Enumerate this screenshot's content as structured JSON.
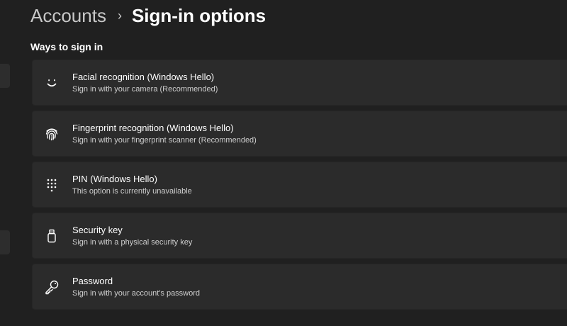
{
  "breadcrumb": {
    "parent": "Accounts",
    "separator": "›",
    "current": "Sign-in options"
  },
  "section": {
    "title": "Ways to sign in"
  },
  "sign_in_options": [
    {
      "icon": "face-icon",
      "title": "Facial recognition (Windows Hello)",
      "subtitle": "Sign in with your camera (Recommended)"
    },
    {
      "icon": "fingerprint-icon",
      "title": "Fingerprint recognition (Windows Hello)",
      "subtitle": "Sign in with your fingerprint scanner (Recommended)"
    },
    {
      "icon": "keypad-icon",
      "title": "PIN (Windows Hello)",
      "subtitle": "This option is currently unavailable"
    },
    {
      "icon": "usb-key-icon",
      "title": "Security key",
      "subtitle": "Sign in with a physical security key"
    },
    {
      "icon": "key-icon",
      "title": "Password",
      "subtitle": "Sign in with your account's password"
    }
  ],
  "colors": {
    "background": "#202020",
    "card": "#2b2b2b",
    "text_primary": "#ffffff",
    "text_secondary": "#cfcfcf"
  }
}
